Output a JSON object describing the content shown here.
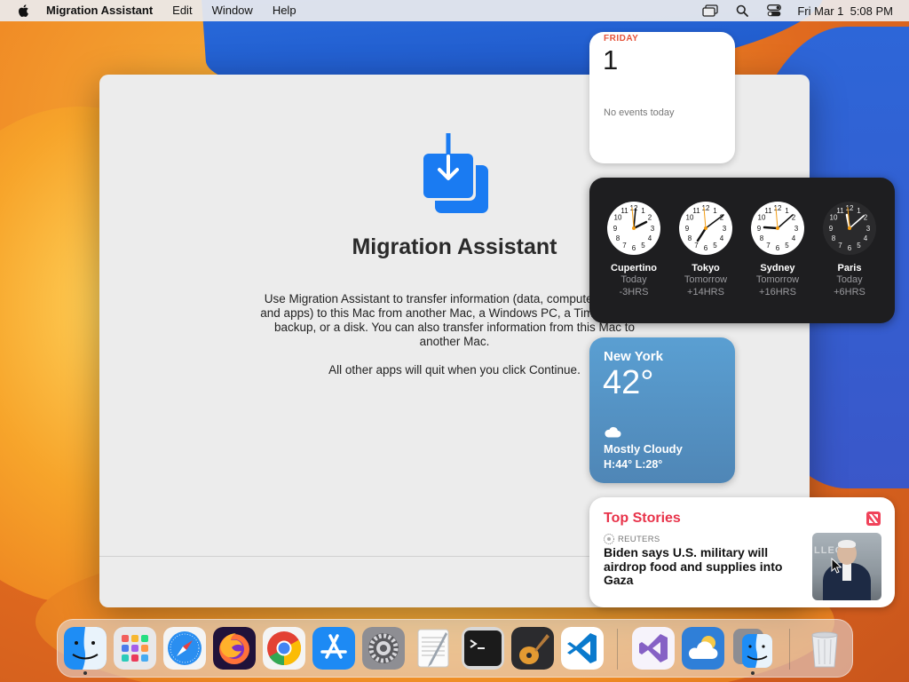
{
  "menubar": {
    "app_name": "Migration Assistant",
    "items": [
      "Edit",
      "Window",
      "Help"
    ],
    "clock": "Fri Mar 1  5:08 PM"
  },
  "window": {
    "title": "Migration Assistant",
    "description": "Use Migration Assistant to transfer information (data, computer settings, and apps) to this Mac from another Mac, a Windows PC, a Time Machine backup, or a disk. You can also transfer information from this Mac to another Mac.",
    "note": "All other apps will quit when you click Continue."
  },
  "calendar": {
    "weekday": "FRIDAY",
    "date": "1",
    "events": "No events today"
  },
  "world_clock": [
    {
      "city": "Cupertino",
      "day": "Today",
      "offset": "-3HRS"
    },
    {
      "city": "Tokyo",
      "day": "Tomorrow",
      "offset": "+14HRS"
    },
    {
      "city": "Sydney",
      "day": "Tomorrow",
      "offset": "+16HRS"
    },
    {
      "city": "Paris",
      "day": "Today",
      "offset": "+6HRS"
    }
  ],
  "weather": {
    "city": "New York",
    "temperature": "42°",
    "condition": "Mostly Cloudy",
    "high_low": "H:44° L:28°",
    "icon": "cloud-icon"
  },
  "news": {
    "title": "Top Stories",
    "source": "REUTERS",
    "headline": "Biden says U.S. military will airdrop food and supplies into Gaza",
    "image_text": "LLEGE"
  },
  "dock": {
    "apps": [
      "Finder",
      "Launchpad",
      "Safari",
      "Firefox",
      "Chrome",
      "App Store",
      "System Settings",
      "TextEdit",
      "Terminal",
      "GarageBand",
      "Visual Studio Code",
      "Visual Studio",
      "Weather",
      "Migration Assistant",
      "Trash"
    ]
  },
  "colors": {
    "accent": "#1a7bf2",
    "news_red": "#e8334a",
    "calendar_red": "#e5533a"
  }
}
